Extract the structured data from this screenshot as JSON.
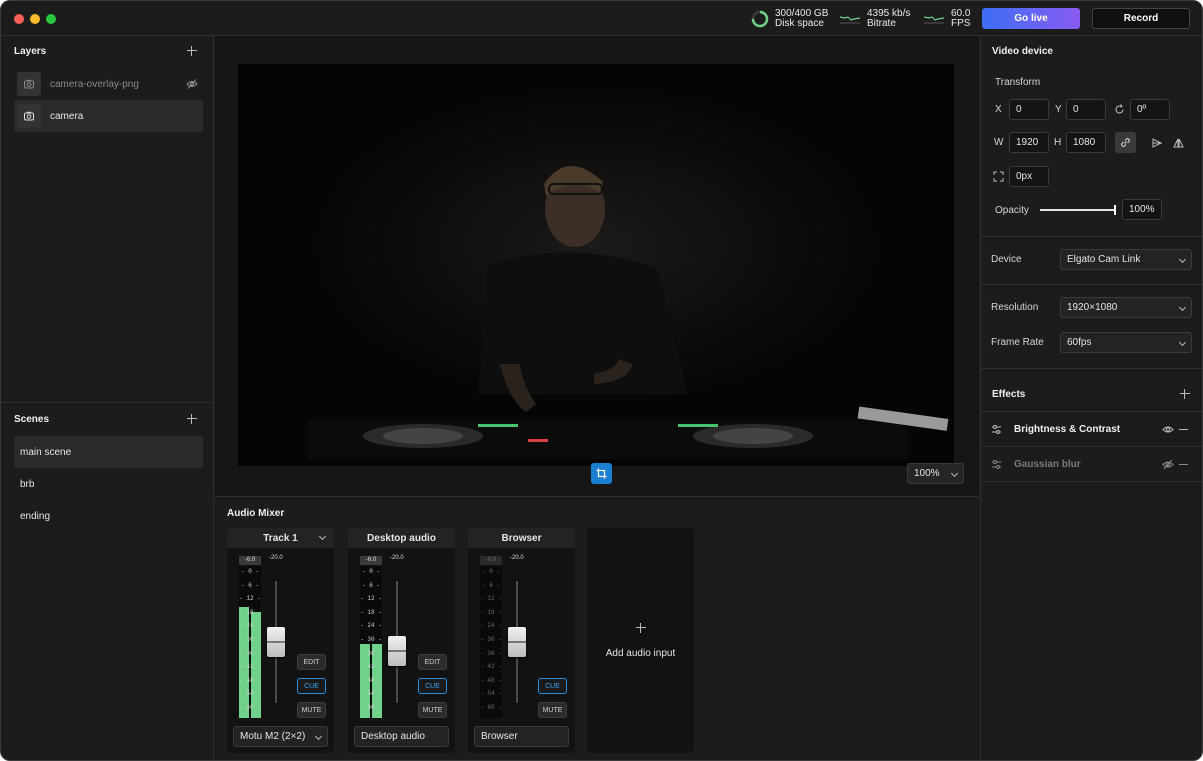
{
  "header": {
    "stats": [
      {
        "value": "300/400 GB",
        "label": "Disk space",
        "icon": "disk-ring-icon"
      },
      {
        "value": "4395 kb/s",
        "label": "Bitrate",
        "icon": "bitrate-graph-icon"
      },
      {
        "value": "60.0",
        "label": "FPS",
        "icon": "fps-graph-icon"
      }
    ],
    "disk_usage_fraction": 0.75,
    "go_live_label": "Go live",
    "record_label": "Record",
    "colors": {
      "accent_start": "#3d6ef5",
      "accent_end": "#8a5cf2",
      "meter_green": "#6fd18a",
      "cue_blue": "#2b8fe0"
    }
  },
  "layers": {
    "title": "Layers",
    "items": [
      {
        "label": "camera-overlay-png",
        "icon": "camera-icon",
        "hidden": true
      },
      {
        "label": "camera",
        "icon": "camera-icon",
        "selected": true
      }
    ]
  },
  "scenes": {
    "title": "Scenes",
    "items": [
      {
        "label": "main scene",
        "selected": true
      },
      {
        "label": "brb"
      },
      {
        "label": "ending"
      }
    ]
  },
  "preview": {
    "zoom": "100%"
  },
  "mixer": {
    "title": "Audio Mixer",
    "peak_label": "-6.0",
    "top_db": "-20.0",
    "scale": [
      "0",
      "6",
      "12",
      "18",
      "24",
      "30",
      "36",
      "42",
      "48",
      "54",
      "60"
    ],
    "tracks": [
      {
        "name": "Track 1",
        "has_dropdown": true,
        "level_left": 0.73,
        "level_right": 0.7,
        "fader": 0.5,
        "edit_label": "EDIT",
        "cue_label": "CUE",
        "mute_label": "MUTE",
        "input": "Motu M2 (2×2)",
        "input_dropdown": true
      },
      {
        "name": "Desktop audio",
        "has_dropdown": false,
        "level_left": 0.49,
        "level_right": 0.49,
        "fader": 0.4,
        "edit_label": "EDIT",
        "cue_label": "CUE",
        "mute_label": "MUTE",
        "input": "Desktop audio",
        "input_dropdown": false
      },
      {
        "name": "Browser",
        "has_dropdown": false,
        "level_left": 0,
        "level_right": 0,
        "fader": 0.5,
        "edit_label": "",
        "cue_label": "CUE",
        "mute_label": "MUTE",
        "input": "Browser",
        "input_dropdown": false
      }
    ],
    "add_label": "Add audio input"
  },
  "video_device": {
    "title": "Video device",
    "transform_label": "Transform",
    "x_label": "X",
    "x": "0",
    "y_label": "Y",
    "y": "0",
    "rotation": "0º",
    "w_label": "W",
    "w": "1920",
    "h_label": "H",
    "h": "1080",
    "radius": "0px",
    "opacity_label": "Opacity",
    "opacity": "100%",
    "opacity_value": 1.0,
    "device_label": "Device",
    "device": "Elgato Cam Link",
    "resolution_label": "Resolution",
    "resolution": "1920×1080",
    "frame_rate_label": "Frame Rate",
    "frame_rate": "60fps"
  },
  "effects": {
    "title": "Effects",
    "items": [
      {
        "label": "Brightness & Contrast",
        "visible": true
      },
      {
        "label": "Gaussian blur",
        "visible": false
      }
    ]
  }
}
